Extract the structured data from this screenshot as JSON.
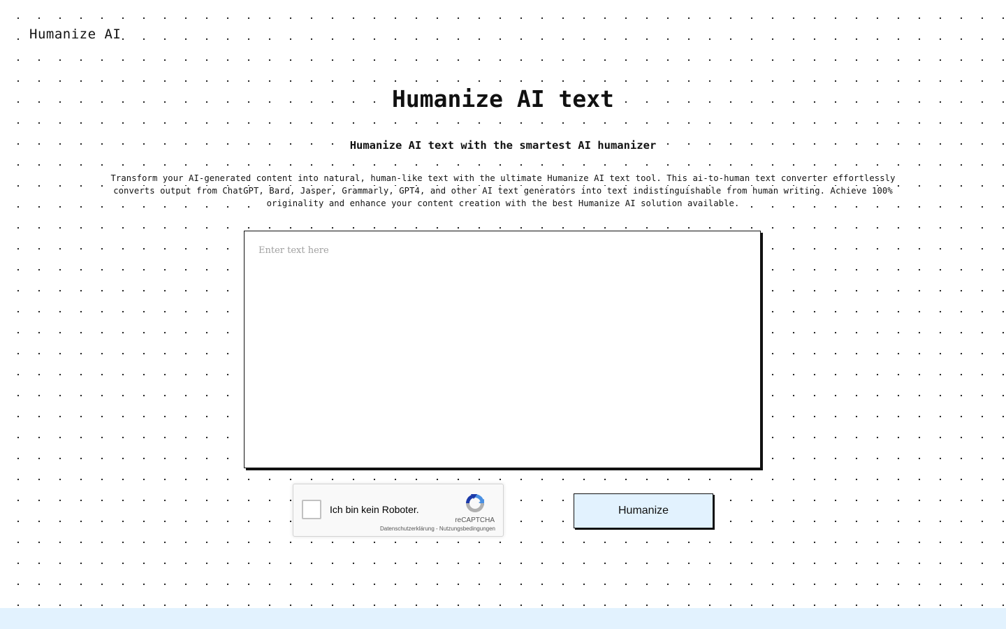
{
  "header": {
    "brand": "Humanize AI"
  },
  "hero": {
    "title": "Humanize AI text",
    "subtitle": "Humanize AI text with the smartest AI humanizer",
    "description": "Transform your AI-generated content into natural, human-like text with the ultimate Humanize AI text tool. This ai-to-human text converter effortlessly converts output from ChatGPT, Bard, Jasper, Grammarly, GPT4, and other AI text generators into text indistinguishable from human writing. Achieve 100% originality and enhance your content creation with the best Humanize AI solution available."
  },
  "editor": {
    "placeholder": "Enter text here",
    "value": ""
  },
  "recaptcha": {
    "checkbox_label": "Ich bin kein Roboter.",
    "brand": "reCAPTCHA",
    "privacy_link": "Datenschutzerklärung",
    "separator": " - ",
    "terms_link": "Nutzungsbedingungen",
    "icon": "recaptcha-logo-icon",
    "checked": false
  },
  "actions": {
    "humanize_label": "Humanize"
  },
  "colors": {
    "accent": "#e2f2fe",
    "border": "#111111",
    "dot": "#1a1a1a",
    "recaptcha_blue": "#4a90e2",
    "recaptcha_grey": "#b0b0b0"
  }
}
